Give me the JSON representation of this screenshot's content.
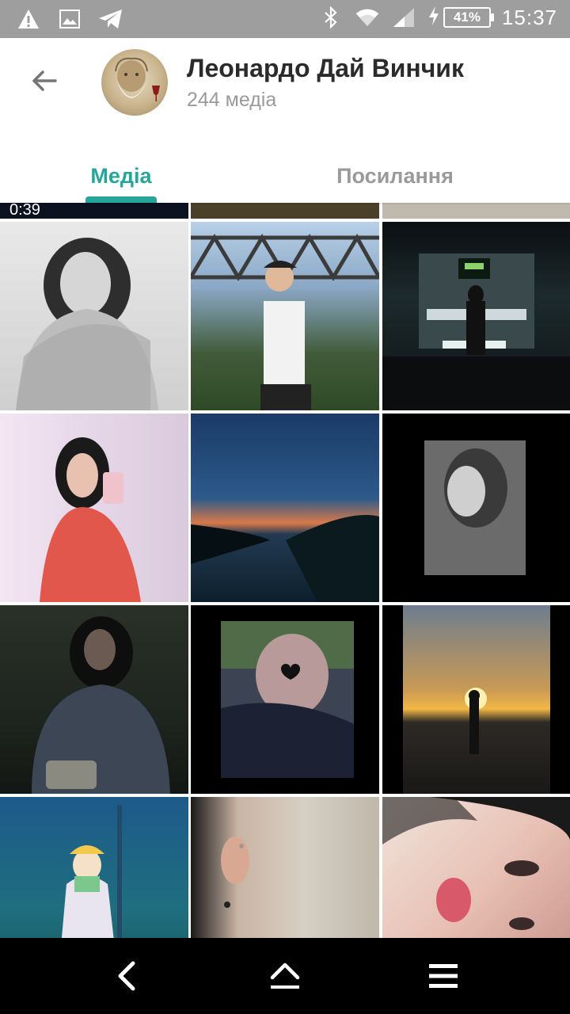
{
  "status_bar": {
    "battery": "41%",
    "time": "15:37",
    "icons": [
      "warning-icon",
      "image-icon",
      "telegram-icon",
      "bluetooth-icon",
      "wifi-icon",
      "signal-icon",
      "charging-icon"
    ]
  },
  "header": {
    "title": "Леонардо Дай Винчик",
    "subtitle": "244 медіа"
  },
  "tabs": [
    {
      "label": "Медіа",
      "active": true
    },
    {
      "label": "Посилання",
      "active": false
    }
  ],
  "media": {
    "partial_row_duration": "0:39"
  },
  "colors": {
    "accent": "#26a69a",
    "status_bar": "#9e9e9e",
    "nav_bar": "#000000"
  }
}
